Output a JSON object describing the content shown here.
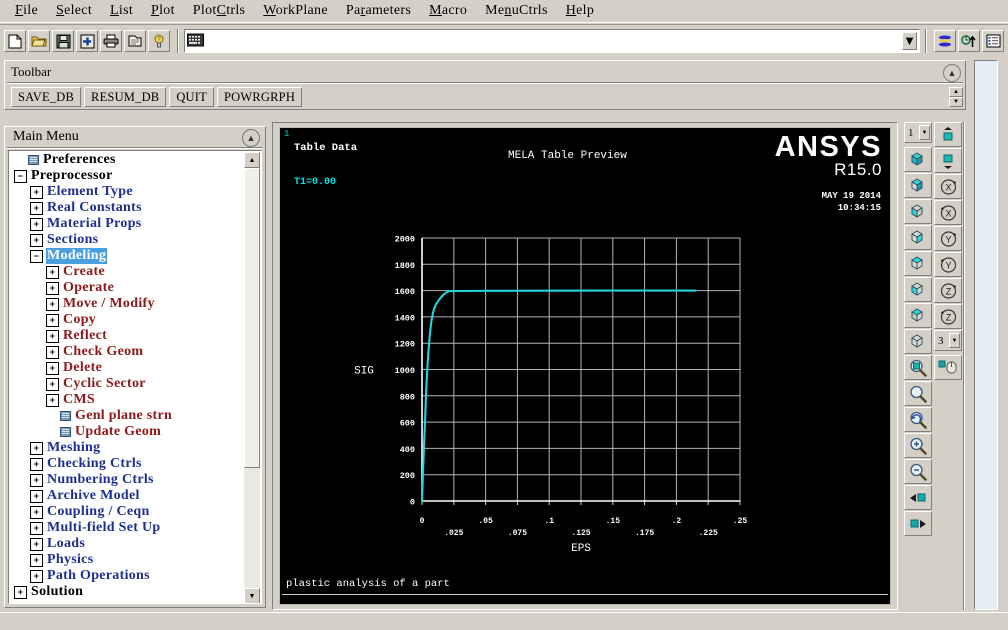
{
  "menubar": [
    {
      "label": "File",
      "accel": "F"
    },
    {
      "label": "Select",
      "accel": "S"
    },
    {
      "label": "List",
      "accel": "L"
    },
    {
      "label": "Plot",
      "accel": "P"
    },
    {
      "label": "PlotCtrls",
      "accel": "C"
    },
    {
      "label": "WorkPlane",
      "accel": "W"
    },
    {
      "label": "Parameters",
      "accel": "r"
    },
    {
      "label": "Macro",
      "accel": "M"
    },
    {
      "label": "MenuCtrls",
      "accel": "n"
    },
    {
      "label": "Help",
      "accel": "H"
    }
  ],
  "iconbar": {
    "buttons": [
      {
        "name": "new-file-icon",
        "title": "New"
      },
      {
        "name": "open-folder-icon",
        "title": "Open"
      },
      {
        "name": "save-icon",
        "title": "Save"
      },
      {
        "name": "resume-db-icon",
        "title": "Resume"
      },
      {
        "name": "print-icon",
        "title": "Print"
      },
      {
        "name": "report-generator-icon",
        "title": "Report"
      },
      {
        "name": "help-question-icon",
        "title": "Help"
      }
    ],
    "right_buttons": [
      {
        "name": "contour-plot-icon",
        "title": "Contour"
      },
      {
        "name": "power-graphics-icon",
        "title": "PowerGraphics"
      },
      {
        "name": "list-results-icon",
        "title": "List"
      }
    ],
    "command_value": "",
    "command_placeholder": ""
  },
  "toolbar_panel": {
    "title": "Toolbar",
    "buttons": [
      "SAVE_DB",
      "RESUM_DB",
      "QUIT",
      "POWRGRPH"
    ]
  },
  "main_menu": {
    "title": "Main Menu",
    "items": [
      {
        "label": "Preferences",
        "depth": 0,
        "toggle": "none",
        "icon": "leaf",
        "color": "#000000",
        "bold": true
      },
      {
        "label": "Preprocessor",
        "depth": 0,
        "toggle": "minus",
        "icon": "none",
        "color": "#000000",
        "bold": true
      },
      {
        "label": "Element Type",
        "depth": 1,
        "toggle": "plus",
        "icon": "none",
        "color": "#1f2f8f"
      },
      {
        "label": "Real Constants",
        "depth": 1,
        "toggle": "plus",
        "icon": "none",
        "color": "#1f2f8f"
      },
      {
        "label": "Material Props",
        "depth": 1,
        "toggle": "plus",
        "icon": "none",
        "color": "#1f2f8f"
      },
      {
        "label": "Sections",
        "depth": 1,
        "toggle": "plus",
        "icon": "none",
        "color": "#1f2f8f"
      },
      {
        "label": "Modeling",
        "depth": 1,
        "toggle": "minus",
        "icon": "none",
        "color": "#1f2f8f",
        "selected": true
      },
      {
        "label": "Create",
        "depth": 2,
        "toggle": "plus",
        "icon": "none",
        "color": "#8b1a1a"
      },
      {
        "label": "Operate",
        "depth": 2,
        "toggle": "plus",
        "icon": "none",
        "color": "#8b1a1a"
      },
      {
        "label": "Move / Modify",
        "depth": 2,
        "toggle": "plus",
        "icon": "none",
        "color": "#8b1a1a"
      },
      {
        "label": "Copy",
        "depth": 2,
        "toggle": "plus",
        "icon": "none",
        "color": "#8b1a1a"
      },
      {
        "label": "Reflect",
        "depth": 2,
        "toggle": "plus",
        "icon": "none",
        "color": "#8b1a1a"
      },
      {
        "label": "Check Geom",
        "depth": 2,
        "toggle": "plus",
        "icon": "none",
        "color": "#8b1a1a"
      },
      {
        "label": "Delete",
        "depth": 2,
        "toggle": "plus",
        "icon": "none",
        "color": "#8b1a1a"
      },
      {
        "label": "Cyclic Sector",
        "depth": 2,
        "toggle": "plus",
        "icon": "none",
        "color": "#8b1a1a"
      },
      {
        "label": "CMS",
        "depth": 2,
        "toggle": "plus",
        "icon": "none",
        "color": "#8b1a1a"
      },
      {
        "label": "Genl plane strn",
        "depth": 2,
        "toggle": "none",
        "icon": "leaf",
        "color": "#8b1a1a"
      },
      {
        "label": "Update Geom",
        "depth": 2,
        "toggle": "none",
        "icon": "leaf",
        "color": "#8b1a1a"
      },
      {
        "label": "Meshing",
        "depth": 1,
        "toggle": "plus",
        "icon": "none",
        "color": "#1f2f8f"
      },
      {
        "label": "Checking Ctrls",
        "depth": 1,
        "toggle": "plus",
        "icon": "none",
        "color": "#1f2f8f"
      },
      {
        "label": "Numbering Ctrls",
        "depth": 1,
        "toggle": "plus",
        "icon": "none",
        "color": "#1f2f8f"
      },
      {
        "label": "Archive Model",
        "depth": 1,
        "toggle": "plus",
        "icon": "none",
        "color": "#1f2f8f"
      },
      {
        "label": "Coupling / Ceqn",
        "depth": 1,
        "toggle": "plus",
        "icon": "none",
        "color": "#1f2f8f"
      },
      {
        "label": "Multi-field Set Up",
        "depth": 1,
        "toggle": "plus",
        "icon": "none",
        "color": "#1f2f8f"
      },
      {
        "label": "Loads",
        "depth": 1,
        "toggle": "plus",
        "icon": "none",
        "color": "#1f2f8f"
      },
      {
        "label": "Physics",
        "depth": 1,
        "toggle": "plus",
        "icon": "none",
        "color": "#1f2f8f"
      },
      {
        "label": "Path Operations",
        "depth": 1,
        "toggle": "plus",
        "icon": "none",
        "color": "#1f2f8f"
      },
      {
        "label": "Solution",
        "depth": 0,
        "toggle": "plus",
        "icon": "none",
        "color": "#000000",
        "bold": true
      }
    ]
  },
  "graphics": {
    "window_number": "1",
    "header_left": "Table Data",
    "header_center": "MELA Table Preview",
    "temp_label": "T1=0.00",
    "logo": "ANSYS",
    "release": "R15.0",
    "date": "MAY 19 2014",
    "time": "10:34:15",
    "footer": "plastic analysis of a part",
    "curve_color": "#22d3dd",
    "grid_color": "#b4b4b4",
    "text_color": "#ffffff"
  },
  "chart_data": {
    "type": "line",
    "title": "MELA Table Preview",
    "subtitle": "Table Data",
    "xlabel": "EPS",
    "ylabel": "SIG",
    "xlim": [
      0,
      0.25
    ],
    "ylim": [
      0,
      2000
    ],
    "grid": true,
    "legend": "none",
    "annotations": [
      "T1=0.00",
      "plastic analysis of a part"
    ],
    "xticks": [
      0,
      0.025,
      0.05,
      0.075,
      0.1,
      0.125,
      0.15,
      0.175,
      0.2,
      0.225,
      0.25
    ],
    "xticklabels": [
      "0",
      ".025",
      ".05",
      ".075",
      ".1",
      ".125",
      ".15",
      ".175",
      ".2",
      ".225",
      ".25"
    ],
    "yticks": [
      0,
      200,
      400,
      600,
      800,
      1000,
      1200,
      1400,
      1600,
      1800,
      2000
    ],
    "yticklabels": [
      "0",
      "200",
      "400",
      "600",
      "800",
      "1000",
      "1200",
      "1400",
      "1600",
      "1800",
      "2000"
    ],
    "series": [
      {
        "name": "SIG vs EPS",
        "color": "#22d3dd",
        "x": [
          0,
          0.0008,
          0.0016,
          0.0024,
          0.003,
          0.0036,
          0.0042,
          0.0048,
          0.0054,
          0.006,
          0.0068,
          0.0076,
          0.0086,
          0.0098,
          0.0112,
          0.013,
          0.015,
          0.017,
          0.0195,
          0.0215,
          0.05,
          0.1,
          0.15,
          0.2,
          0.215
        ],
        "y": [
          0,
          220,
          430,
          600,
          760,
          900,
          1010,
          1100,
          1180,
          1250,
          1320,
          1380,
          1430,
          1470,
          1500,
          1525,
          1550,
          1570,
          1588,
          1596,
          1598,
          1599,
          1600,
          1600,
          1600
        ]
      }
    ]
  },
  "right_toolbar": {
    "left_column": [
      {
        "name": "view-number-combo",
        "type": "combo",
        "value": "1"
      },
      {
        "name": "isometric-view-icon",
        "type": "button"
      },
      {
        "name": "oblique-view-icon",
        "type": "button"
      },
      {
        "name": "front-view-icon",
        "type": "button"
      },
      {
        "name": "back-view-icon",
        "type": "button"
      },
      {
        "name": "left-view-icon",
        "type": "button"
      },
      {
        "name": "right-view-icon",
        "type": "button"
      },
      {
        "name": "top-view-icon",
        "type": "button"
      },
      {
        "name": "bottom-view-icon",
        "type": "button"
      },
      {
        "name": "zoom-window-icon",
        "type": "button"
      },
      {
        "name": "box-zoom-icon",
        "type": "button"
      },
      {
        "name": "fit-view-icon",
        "type": "button"
      },
      {
        "name": "zoom-in-icon",
        "type": "button"
      },
      {
        "name": "zoom-out-icon",
        "type": "button"
      },
      {
        "name": "pan-left-icon",
        "type": "button"
      },
      {
        "name": "pan-right-icon",
        "type": "button"
      }
    ],
    "right_column": [
      {
        "name": "pan-up-icon",
        "type": "button"
      },
      {
        "name": "pan-down-icon",
        "type": "button"
      },
      {
        "name": "rotate-x-plus-icon",
        "type": "button"
      },
      {
        "name": "rotate-x-minus-icon",
        "type": "button"
      },
      {
        "name": "rotate-y-plus-icon",
        "type": "button"
      },
      {
        "name": "rotate-y-minus-icon",
        "type": "button"
      },
      {
        "name": "rotate-z-plus-icon",
        "type": "button"
      },
      {
        "name": "rotate-z-minus-icon",
        "type": "button"
      },
      {
        "name": "rate-combo",
        "type": "combo",
        "value": "3"
      },
      {
        "name": "dynamic-mode-icon",
        "type": "button"
      }
    ]
  }
}
